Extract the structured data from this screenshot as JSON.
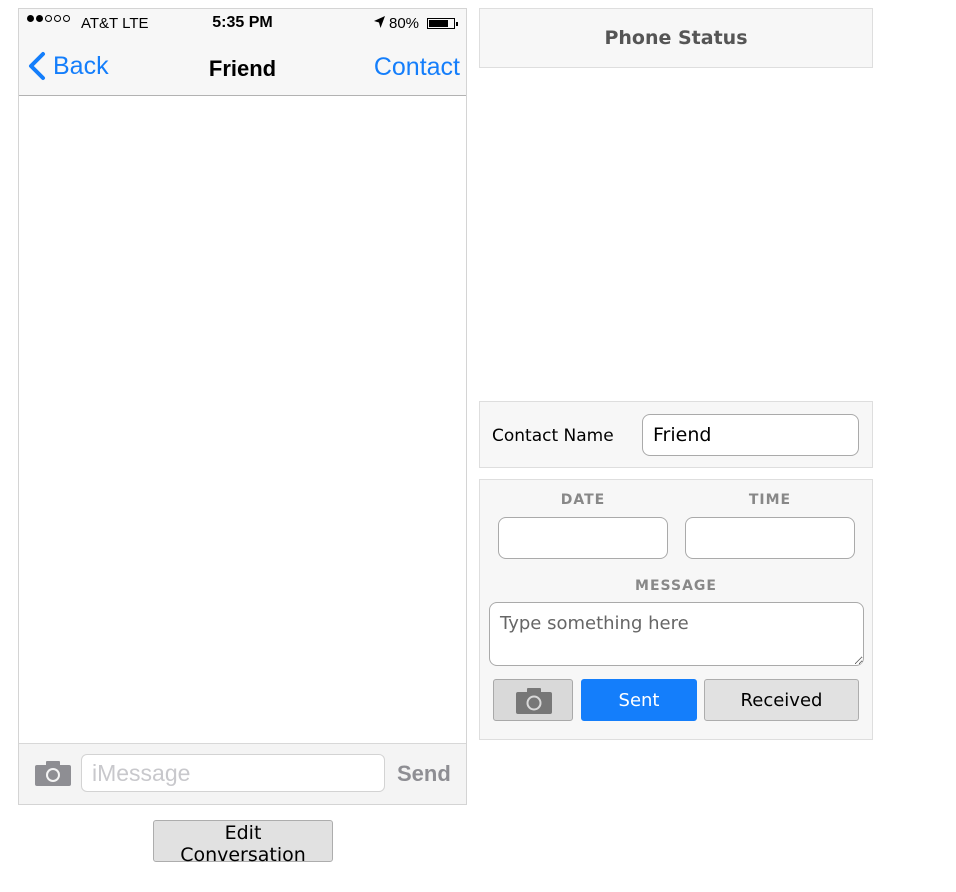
{
  "phone": {
    "status_bar": {
      "carrier": "AT&T LTE",
      "time": "5:35 PM",
      "battery_text": "80%",
      "battery_level": 0.8,
      "signal_bars_filled": 2,
      "signal_bars_total": 5
    },
    "nav": {
      "back_label": "Back",
      "title": "Friend",
      "contact_label": "Contact"
    },
    "composer": {
      "placeholder": "iMessage",
      "send_label": "Send"
    },
    "accent_color": "#147efb"
  },
  "edit_conversation_label": "Edit Conversation",
  "panel": {
    "title": "Phone Status",
    "contact_name_label": "Contact Name",
    "contact_name_value": "Friend",
    "date_label": "DATE",
    "time_label": "TIME",
    "message_label": "MESSAGE",
    "message_placeholder": "Type something here",
    "sent_label": "Sent",
    "received_label": "Received"
  }
}
